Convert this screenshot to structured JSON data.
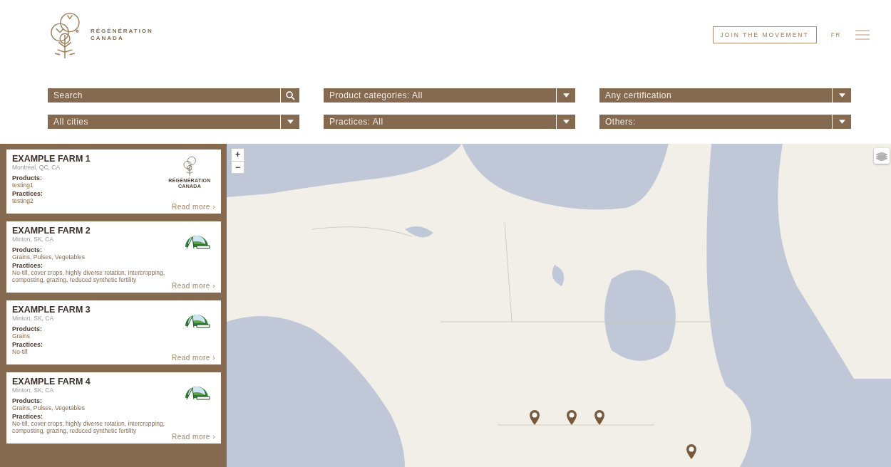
{
  "header": {
    "logo_text": [
      "RÉGÉNÉRATION",
      "CANADA"
    ],
    "join_button": "JOIN THE MOVEMENT",
    "language": "FR"
  },
  "filters": [
    {
      "kind": "search",
      "placeholder": "Search"
    },
    {
      "kind": "select",
      "value": "Product categories: All"
    },
    {
      "kind": "select",
      "value": "Any certification"
    },
    {
      "kind": "select",
      "value": "All cities"
    },
    {
      "kind": "select",
      "value": "Practices: All"
    },
    {
      "kind": "select",
      "value": "Others:"
    }
  ],
  "farms": [
    {
      "name": "EXAMPLE FARM 1",
      "location": "Montréal, QC, CA",
      "products_label": "Products:",
      "products": "testing1",
      "practices_label": "Practices:",
      "practices": "testing2",
      "kind": "regeneration",
      "logo_caption": [
        "RÉGÉNÉRATION",
        "CANADA"
      ],
      "read_more": "Read more ›"
    },
    {
      "name": "EXAMPLE FARM 2",
      "location": "Minton, SK, CA",
      "products_label": "Products:",
      "products": "Grains, Pulses, Vegetables",
      "practices_label": "Practices:",
      "practices": "No-till, cover crops, highly diverse rotation, intercropping, composting, grazing, reduced synthetic fertility",
      "kind": "farm",
      "read_more": "Read more ›"
    },
    {
      "name": "EXAMPLE FARM 3",
      "location": "Minton, SK, CA",
      "products_label": "Products:",
      "products": "Grains",
      "practices_label": "Practices:",
      "practices": "No-till",
      "kind": "farm",
      "read_more": "Read more ›"
    },
    {
      "name": "EXAMPLE FARM 4",
      "location": "Minton, SK, CA",
      "products_label": "Products:",
      "products": "Grains, Pulses, Vegetables",
      "practices_label": "Practices:",
      "practices": "No-till, cover crops, highly diverse rotation, intercropping, composting, grazing, reduced synthetic fertility",
      "kind": "farm",
      "read_more": "Read more ›"
    }
  ],
  "map": {
    "zoom_in": "+",
    "zoom_out": "−"
  }
}
